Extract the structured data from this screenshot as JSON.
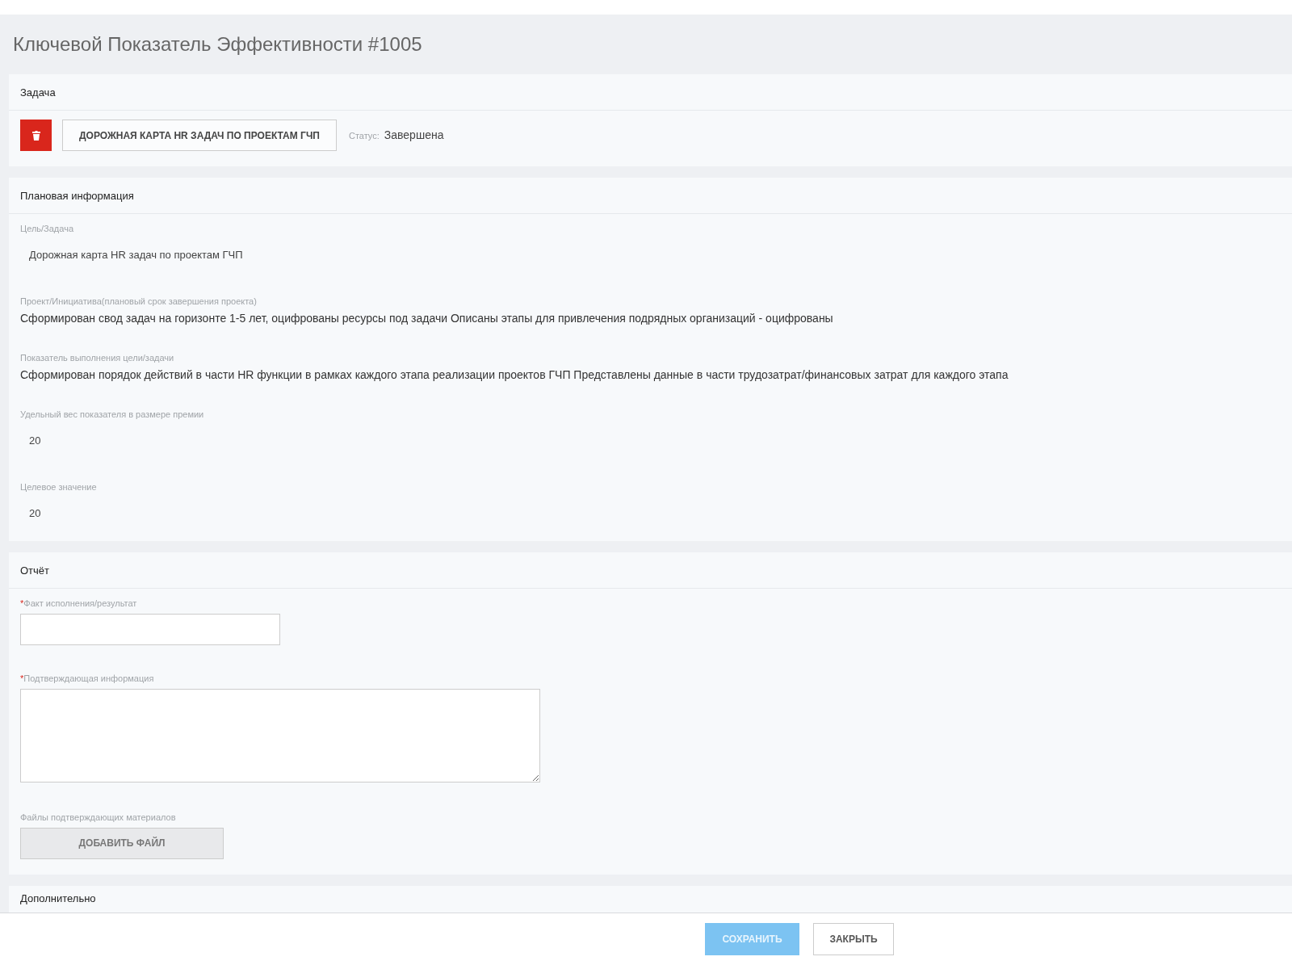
{
  "title": "Ключевой Показатель Эффективности #1005",
  "task": {
    "heading": "Задача",
    "task_button": "ДОРОЖНАЯ КАРТА HR ЗАДАЧ ПО ПРОЕКТАМ ГЧП",
    "status_label": "Статус:",
    "status_value": "Завершена"
  },
  "planned": {
    "heading": "Плановая информация",
    "fields": [
      {
        "label": "Цель/Задача",
        "value": "Дорожная карта HR задач по проектам ГЧП",
        "kind": "short"
      },
      {
        "label": "Проект/Инициатива(плановый срок завершения проекта)",
        "value": "Сформирован свод задач на горизонте 1-5 лет, оцифрованы ресурсы под задачи Описаны этапы для привлечения подрядных организаций - оцифрованы",
        "kind": "long"
      },
      {
        "label": "Показатель выполнения цели/задачи",
        "value": "Сформирован порядок действий в части HR функции в рамках каждого этапа реализации проектов ГЧП Представлены данные в части трудозатрат/финансовых затрат для каждого этапа",
        "kind": "long"
      },
      {
        "label": "Удельный вес показателя в размере премии",
        "value": "20",
        "kind": "short"
      },
      {
        "label": "Целевое значение",
        "value": "20",
        "kind": "short"
      }
    ]
  },
  "report": {
    "heading": "Отчёт",
    "fields": [
      {
        "label": "Факт исполнения/результат",
        "required_mark": "*",
        "kind": "input"
      },
      {
        "label": "Подтверждающая информация",
        "required_mark": "*",
        "kind": "textarea"
      },
      {
        "label": "Файлы подтверждающих материалов",
        "kind": "file",
        "button": "ДОБАВИТЬ ФАЙЛ"
      }
    ]
  },
  "additional": {
    "heading": "Дополнительно"
  },
  "footer_buttons": [
    {
      "label": "СОХРАНИТЬ",
      "kind": "primary",
      "disabled": true
    },
    {
      "label": "ЗАКРЫТЬ",
      "kind": "default",
      "disabled": false
    }
  ]
}
